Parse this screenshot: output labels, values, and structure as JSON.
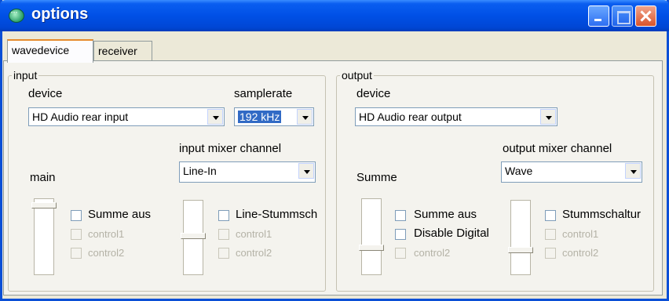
{
  "window": {
    "title": "options",
    "accent": "#0050e6"
  },
  "tabs": [
    {
      "label": "wavedevice",
      "active": true
    },
    {
      "label": "receiver",
      "active": false
    }
  ],
  "input": {
    "legend": "input",
    "device_label": "device",
    "device_value": "HD Audio rear input",
    "samplerate_label": "samplerate",
    "samplerate_value": "192 kHz",
    "mixer_channel_label": "input mixer channel",
    "mixer_channel_value": "Line-In",
    "main_label": "main",
    "main_checks": [
      {
        "label": "Summe aus",
        "enabled": true,
        "checked": false
      },
      {
        "label": "control1",
        "enabled": false,
        "checked": false
      },
      {
        "label": "control2",
        "enabled": false,
        "checked": false
      }
    ],
    "channel_checks": [
      {
        "label": "Line-Stummsch",
        "enabled": true,
        "checked": false
      },
      {
        "label": "control1",
        "enabled": false,
        "checked": false
      },
      {
        "label": "control2",
        "enabled": false,
        "checked": false
      }
    ]
  },
  "output": {
    "legend": "output",
    "device_label": "device",
    "device_value": "HD Audio rear output",
    "mixer_channel_label": "output mixer channel",
    "mixer_channel_value": "Wave",
    "main_label": "Summe",
    "main_checks": [
      {
        "label": "Summe aus",
        "enabled": true,
        "checked": false
      },
      {
        "label": "Disable Digital",
        "enabled": true,
        "checked": false
      },
      {
        "label": "control2",
        "enabled": false,
        "checked": false
      }
    ],
    "channel_checks": [
      {
        "label": "Stummschaltur",
        "enabled": true,
        "checked": false
      },
      {
        "label": "control1",
        "enabled": false,
        "checked": false
      },
      {
        "label": "control2",
        "enabled": false,
        "checked": false
      }
    ]
  }
}
